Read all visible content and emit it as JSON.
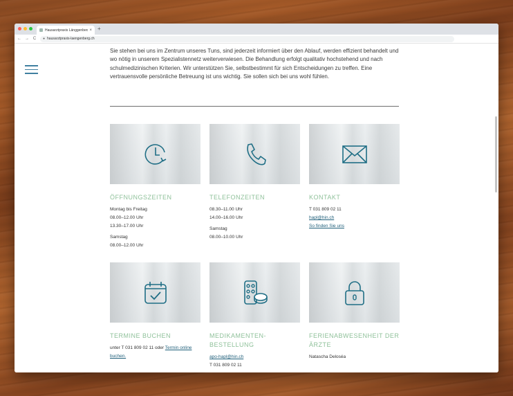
{
  "browser": {
    "tab_title": "Hausarztpraxis Länggenberg H",
    "tab_close": "×",
    "new_tab": "+",
    "back": "←",
    "forward": "→",
    "reload": "C",
    "url": "hausarztpraxis-laengenberg.ch"
  },
  "intro": {
    "text": "Sie stehen bei uns im Zentrum unseres Tuns, sind jederzeit informiert über den Ablauf, werden effizient behandelt und wo nötig in unserem Spezialistennetz weiterverwiesen. Die Behandlung erfolgt qualitativ hochstehend und nach schulmedizinischen Kriterien. Wir unterstützen Sie, selbstbestimmt für sich Entscheidungen zu treffen. Eine vertrauensvolle persönliche Betreuung ist uns wichtig. Sie sollen sich bei uns wohl fühlen."
  },
  "cards": {
    "hours": {
      "icon": "clock-icon",
      "title": "ÖFFNUNGSZEITEN",
      "line1": "Montag bis Freitag",
      "line2": "08.00–12.00 Uhr",
      "line3": "13.30–17.00 Uhr",
      "line4": "Samstag",
      "line5": "08.00–12.00 Uhr"
    },
    "phone": {
      "icon": "phone-icon",
      "title": "TELEFONZEITEN",
      "line1": "08.30–11.00 Uhr",
      "line2": "14.00–16.00 Uhr",
      "line3": "Samstag",
      "line4": "08.00–10.00 Uhr"
    },
    "contact": {
      "icon": "envelope-icon",
      "title": "KONTAKT",
      "phone": "T 031 809 02 11",
      "email": "hapl@hin.ch",
      "directions": "So finden Sie uns"
    },
    "booking": {
      "icon": "calendar-check-icon",
      "title": "TERMINE BUCHEN",
      "text": "unter T 031 809 02 11 oder ",
      "link": "Termin online buchen."
    },
    "medication": {
      "icon": "pills-icon",
      "title_line1": "MEDIKAMENTEN-",
      "title_line2": "BESTELLUNG",
      "email": "apo-hapl@hin.ch",
      "phone": "T 031 809 02 11"
    },
    "holiday": {
      "icon": "lock-icon",
      "title_line1": "FERIENABWESENHEIT DER",
      "title_line2": "ÄRZTE",
      "name": "Natascha Deloséa"
    }
  },
  "colors": {
    "accent_green": "#8fc19a",
    "icon_teal": "#1f6e85",
    "link_blue": "#1f5f7a"
  }
}
